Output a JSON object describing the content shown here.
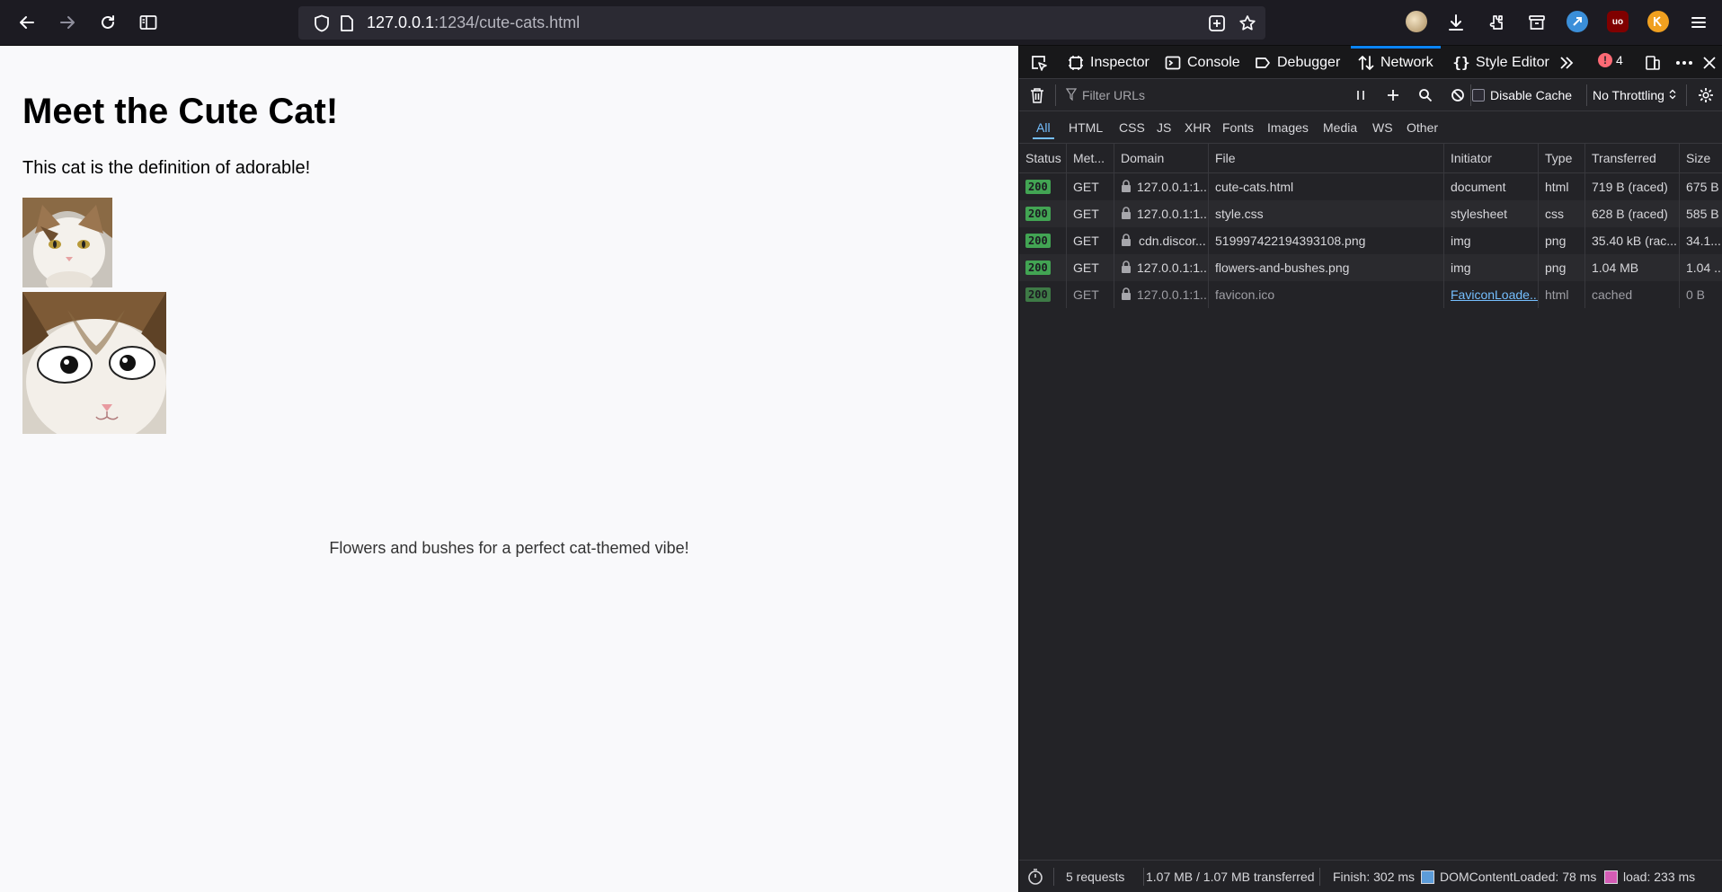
{
  "browser": {
    "url_host": "127.0.0.1",
    "url_rest": ":1234/cute-cats.html",
    "icons": [
      "back-icon",
      "forward-icon",
      "reload-icon",
      "sidebar-icon",
      "shield-icon",
      "page-icon",
      "add-to-page-icon",
      "bookmark-star-icon",
      "profile-icon",
      "download-icon",
      "extensions-icon",
      "container-icon",
      "extension-blue-icon",
      "ublock-icon",
      "extension-orange-icon",
      "menu-icon"
    ],
    "ublock_label": "uo"
  },
  "page": {
    "heading": "Meet the Cute Cat!",
    "intro": "This cat is the definition of adorable!",
    "caption": "Flowers and bushes for a perfect cat-themed vibe!"
  },
  "devtools": {
    "tabs": [
      {
        "label": "Inspector",
        "icon": "inspector-icon"
      },
      {
        "label": "Console",
        "icon": "console-icon"
      },
      {
        "label": "Debugger",
        "icon": "debugger-icon"
      },
      {
        "label": "Network",
        "icon": "network-icon",
        "active": true
      },
      {
        "label": "Style Editor",
        "icon": "style-editor-icon"
      }
    ],
    "error_count": "4",
    "filter_placeholder": "Filter URLs",
    "disable_cache_label": "Disable Cache",
    "throttling_label": "No Throttling",
    "type_filters": [
      "All",
      "HTML",
      "CSS",
      "JS",
      "XHR",
      "Fonts",
      "Images",
      "Media",
      "WS",
      "Other"
    ],
    "active_type_filter": "All",
    "columns": [
      "Status",
      "Met...",
      "Domain",
      "File",
      "Initiator",
      "Type",
      "Transferred",
      "Size"
    ],
    "requests": [
      {
        "status": "200",
        "method": "GET",
        "domain": "127.0.0.1:1...",
        "file": "cute-cats.html",
        "initiator": "document",
        "type": "html",
        "transferred": "719 B (raced)",
        "size": "675 B"
      },
      {
        "status": "200",
        "method": "GET",
        "domain": "127.0.0.1:1...",
        "file": "style.css",
        "initiator": "stylesheet",
        "type": "css",
        "transferred": "628 B (raced)",
        "size": "585 B"
      },
      {
        "status": "200",
        "method": "GET",
        "domain": "cdn.discor...",
        "file": "519997422194393108.png",
        "initiator": "img",
        "type": "png",
        "transferred": "35.40 kB (rac...",
        "size": "34.1..."
      },
      {
        "status": "200",
        "method": "GET",
        "domain": "127.0.0.1:1...",
        "file": "flowers-and-bushes.png",
        "initiator": "img",
        "type": "png",
        "transferred": "1.04 MB",
        "size": "1.04 ..."
      },
      {
        "status": "200",
        "method": "GET",
        "domain": "127.0.0.1:1...",
        "file": "favicon.ico",
        "initiator": "FaviconLoade...",
        "type": "html",
        "transferred": "cached",
        "size": "0 B"
      }
    ],
    "status_bar": {
      "requests": "5 requests",
      "transferred": "1.07 MB / 1.07 MB transferred",
      "finish": "Finish: 302 ms",
      "domcontentloaded": "DOMContentLoaded: 78 ms",
      "load": "load: 233 ms"
    },
    "colors": {
      "accent": "#0a84ff",
      "status_ok": "#42a453",
      "domcontentloaded": "#5c9cd9",
      "load": "#d45cb5",
      "link": "#75bfff"
    }
  }
}
